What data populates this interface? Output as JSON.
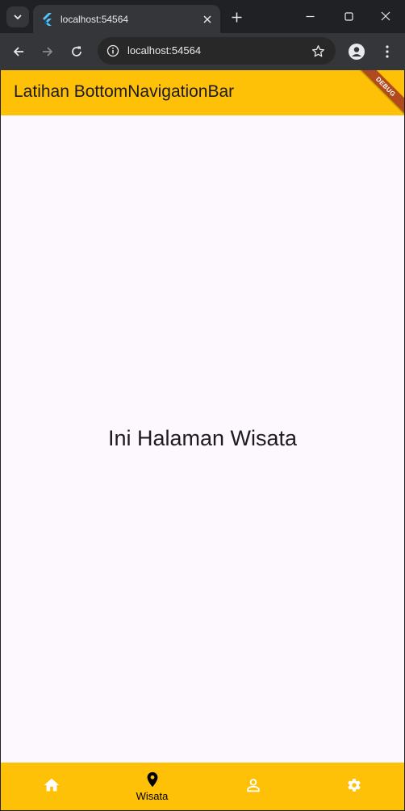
{
  "browser": {
    "tab_title": "localhost:54564",
    "url": "localhost:54564"
  },
  "app": {
    "appbar_title": "Latihan BottomNavigationBar",
    "debug_label": "DEBUG",
    "page_text": "Ini Halaman Wisata",
    "accent_color": "#ffc107",
    "background_color": "#fdf7fe",
    "bottom_nav": {
      "items": [
        {
          "icon": "home-icon",
          "label": ""
        },
        {
          "icon": "location-pin-icon",
          "label": "Wisata",
          "selected": true
        },
        {
          "icon": "person-icon",
          "label": ""
        },
        {
          "icon": "settings-gear-icon",
          "label": ""
        }
      ]
    }
  }
}
